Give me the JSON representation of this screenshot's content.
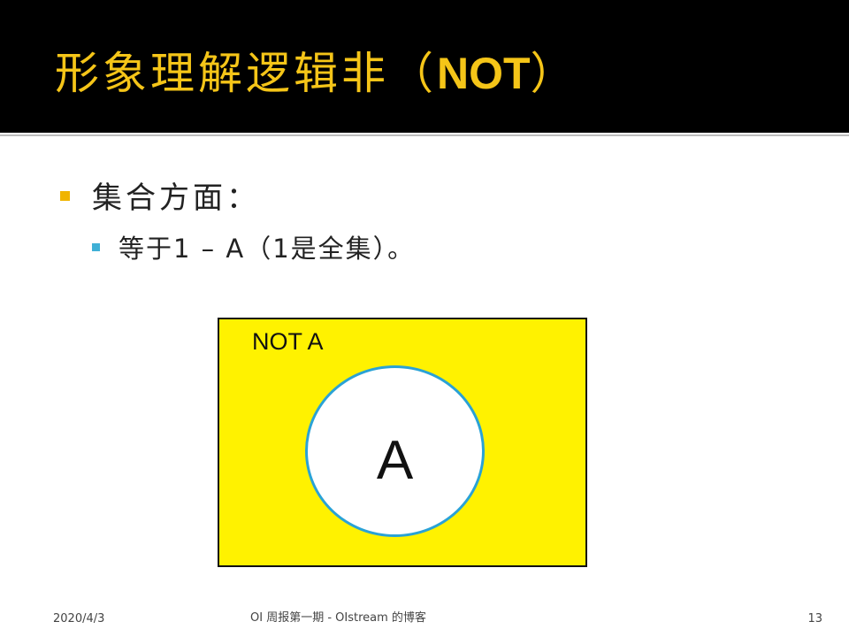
{
  "slide": {
    "title_cn": "形象理解逻辑非（",
    "title_latin": "NOT",
    "title_close": "）",
    "bullet_1": "集合方面：",
    "bullet_2": "等于1 – A（1是全集）。"
  },
  "venn": {
    "outer_label": "NOT A",
    "inner_label": "A"
  },
  "footer": {
    "date": "2020/4/3",
    "center": "OI 周报第一期 - OIstream 的博客",
    "page": "13"
  },
  "colors": {
    "title_bar": "#000000",
    "title_text": "#f5c518",
    "bullet_1": "#f0b400",
    "bullet_2": "#3fb0d6",
    "venn_fill": "#fff200",
    "circle_border": "#2aa2d6"
  }
}
